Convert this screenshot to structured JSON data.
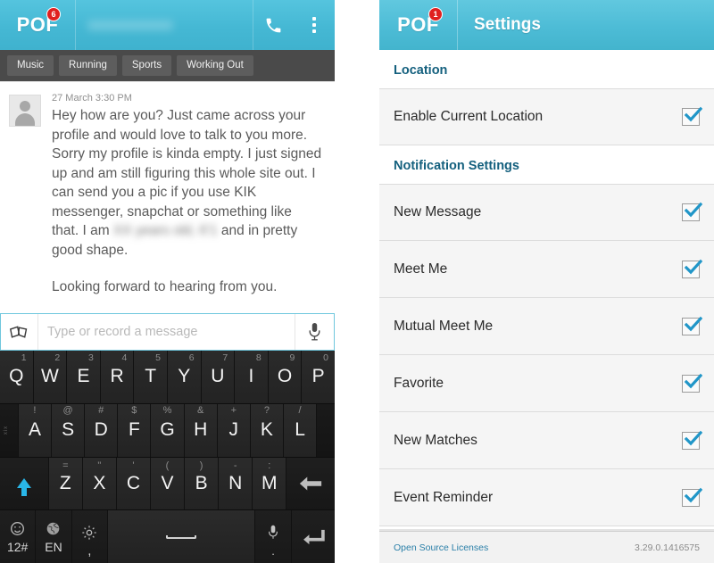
{
  "chat": {
    "header": {
      "logo": "POF",
      "badge_count": "6",
      "peer_name": "xxxxxxxxxx",
      "call_icon": "phone-icon",
      "overflow_icon": "overflow-menu-icon"
    },
    "tabs": [
      {
        "label": "Music"
      },
      {
        "label": "Running"
      },
      {
        "label": "Sports"
      },
      {
        "label": "Working Out"
      }
    ],
    "message": {
      "timestamp": "27 March 3:30 PM",
      "body_part1": "Hey how are you? Just came across your profile and would love to talk to you more. Sorry my profile is kinda empty. I just signed up and am still figuring this whole site out.  I can send you a pic if you use KIK messenger, snapchat or something like that. I am ",
      "redacted": "XX years old, 6'1",
      "body_part2": " and in pretty good shape.",
      "body_part3": "Looking forward to hearing from you."
    },
    "composer": {
      "attach_icon": "cards-icon",
      "placeholder": "Type or record a message",
      "value": "",
      "mic_icon": "microphone-icon"
    }
  },
  "keyboard": {
    "row1": [
      {
        "key": "Q",
        "hint": "1"
      },
      {
        "key": "W",
        "hint": "2"
      },
      {
        "key": "E",
        "hint": "3"
      },
      {
        "key": "R",
        "hint": "4"
      },
      {
        "key": "T",
        "hint": "5"
      },
      {
        "key": "Y",
        "hint": "6"
      },
      {
        "key": "U",
        "hint": "7"
      },
      {
        "key": "I",
        "hint": "8"
      },
      {
        "key": "O",
        "hint": "9"
      },
      {
        "key": "P",
        "hint": "0"
      }
    ],
    "row2": [
      {
        "key": "A",
        "hint": "!"
      },
      {
        "key": "S",
        "hint": "@"
      },
      {
        "key": "D",
        "hint": "#"
      },
      {
        "key": "F",
        "hint": "$"
      },
      {
        "key": "G",
        "hint": "%"
      },
      {
        "key": "H",
        "hint": "&"
      },
      {
        "key": "J",
        "hint": "+"
      },
      {
        "key": "K",
        "hint": "?"
      },
      {
        "key": "L",
        "hint": "/"
      }
    ],
    "row3": [
      {
        "key": "Z",
        "hint": "="
      },
      {
        "key": "X",
        "hint": "\""
      },
      {
        "key": "C",
        "hint": "'"
      },
      {
        "key": "V",
        "hint": "("
      },
      {
        "key": "B",
        "hint": ")"
      },
      {
        "key": "N",
        "hint": "-"
      },
      {
        "key": "M",
        "hint": ":"
      }
    ],
    "shift_icon": "shift-arrow-icon",
    "backspace_icon": "backspace-icon",
    "sym_label": "12#",
    "sym_icon": "emoji-icon",
    "lang_label": "EN",
    "lang_icon": "globe-icon",
    "settings_icon": "gear-icon",
    "settings_sub": ",",
    "space_icon": "spacebar-icon",
    "mic_icon": "microphone-icon",
    "mic_sub": ".",
    "enter_icon": "enter-icon"
  },
  "settings": {
    "header": {
      "logo": "POF",
      "badge_count": "1",
      "title": "Settings"
    },
    "sections": [
      {
        "title": "Location",
        "rows": [
          {
            "label": "Enable Current Location",
            "checked": true
          }
        ]
      },
      {
        "title": "Notification Settings",
        "rows": [
          {
            "label": "New Message",
            "checked": true
          },
          {
            "label": "Meet Me",
            "checked": true
          },
          {
            "label": "Mutual Meet Me",
            "checked": true
          },
          {
            "label": "Favorite",
            "checked": true
          },
          {
            "label": "New Matches",
            "checked": true
          },
          {
            "label": "Event Reminder",
            "checked": true
          }
        ]
      }
    ],
    "footer": {
      "link": "Open Source Licenses",
      "version": "3.29.0.1416575"
    }
  },
  "colors": {
    "header_teal": "#45b8d4",
    "badge_red": "#e02020",
    "section_header": "#14607e",
    "checkbox_blue": "#2196c8",
    "tabbar_gray": "#4a4a4a"
  }
}
